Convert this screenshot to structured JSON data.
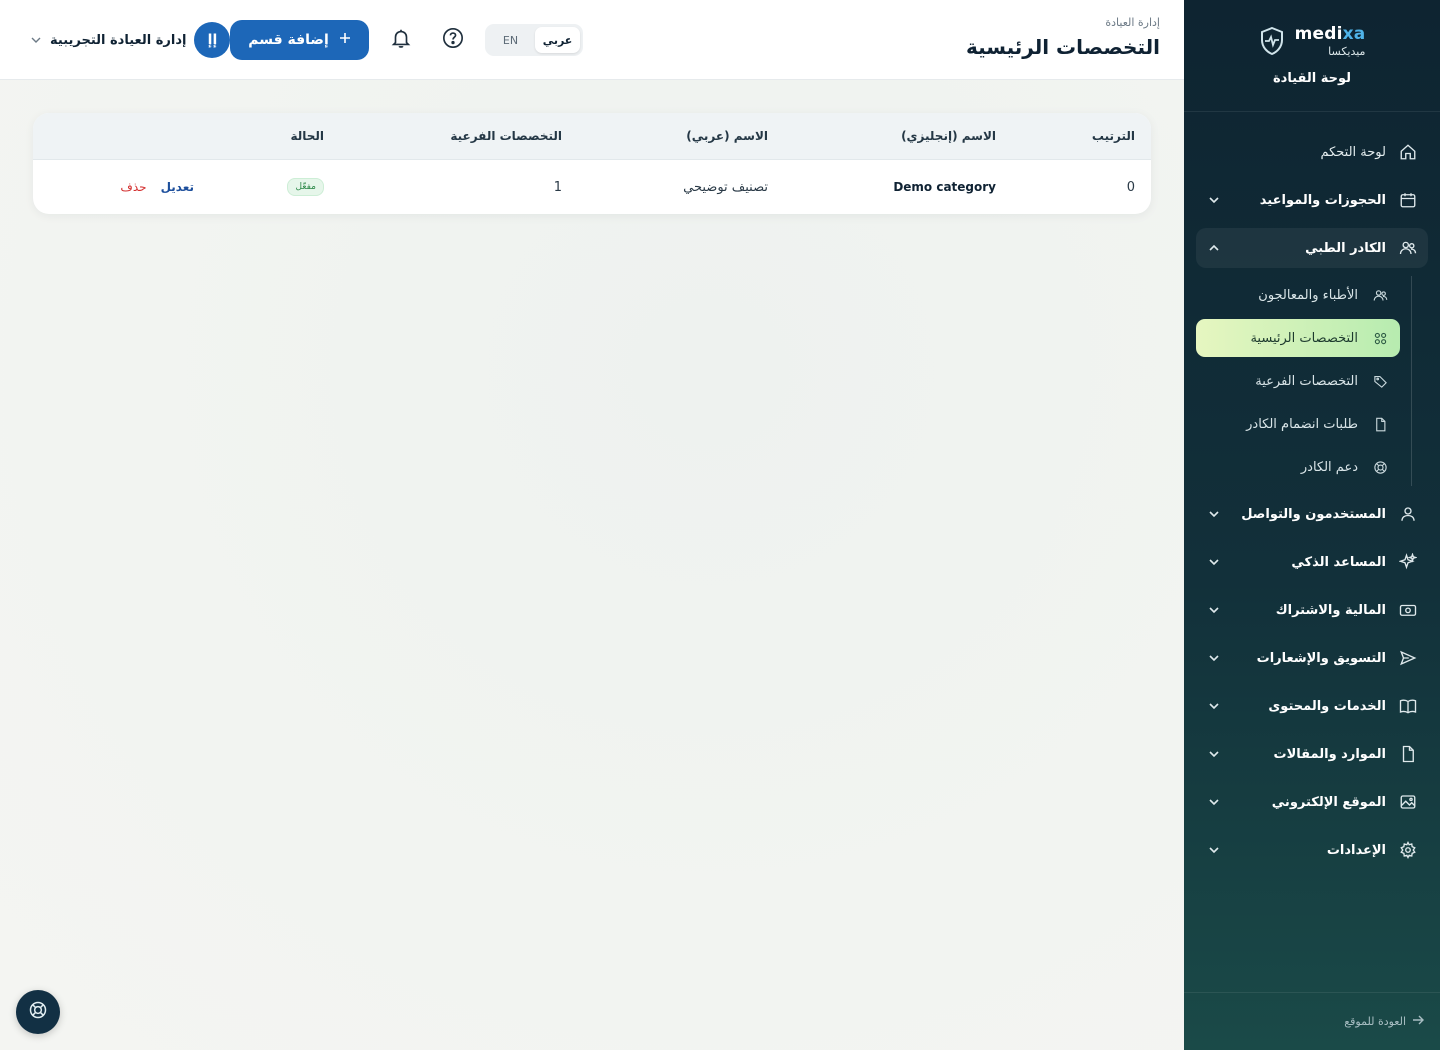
{
  "brand": {
    "name_prefix": "medi",
    "name_accent": "xa",
    "name_ar": "ميديكسا",
    "subtitle": "لوحة القيادة"
  },
  "header": {
    "breadcrumb": "إدارة العيادة",
    "title": "التخصصات الرئيسية",
    "lang_ar": "عربي",
    "lang_en": "EN",
    "add_button": "إضافة قسم",
    "user_initials": "إإ",
    "user_name": "إدارة العيادة التجريبية"
  },
  "sidebar": {
    "items": [
      {
        "label": "لوحة التحكم",
        "icon": "home-icon"
      },
      {
        "label": "الحجوزات والمواعيد",
        "icon": "calendar-icon"
      },
      {
        "label": "الكادر الطبي",
        "icon": "users-icon"
      },
      {
        "label": "المستخدمون والتواصل",
        "icon": "user-icon"
      },
      {
        "label": "المساعد الذكي",
        "icon": "sparkles-icon"
      },
      {
        "label": "المالية والاشتراك",
        "icon": "money-icon"
      },
      {
        "label": "التسويق والإشعارات",
        "icon": "send-icon"
      },
      {
        "label": "الخدمات والمحتوى",
        "icon": "book-icon"
      },
      {
        "label": "الموارد والمقالات",
        "icon": "file-icon"
      },
      {
        "label": "الموقع الإلكتروني",
        "icon": "image-icon"
      },
      {
        "label": "الإعدادات",
        "icon": "gear-icon"
      }
    ],
    "sub_items": [
      {
        "label": "الأطباء والمعالجون",
        "icon": "users-icon"
      },
      {
        "label": "التخصصات الرئيسية",
        "icon": "grid-icon"
      },
      {
        "label": "التخصصات الفرعية",
        "icon": "tag-icon"
      },
      {
        "label": "طلبات انضمام الكادر",
        "icon": "document-icon"
      },
      {
        "label": "دعم الكادر",
        "icon": "lifebuoy-icon"
      }
    ],
    "back_link": "العودة للموقع"
  },
  "table": {
    "columns": [
      "الترتيب",
      "الاسم (إنجليزي)",
      "الاسم (عربي)",
      "التخصصات الفرعية",
      "الحالة",
      ""
    ],
    "rows": [
      {
        "order": "0",
        "name_en": "Demo category",
        "name_ar": "تصنيف توضيحي",
        "sub_count": "1",
        "status": "مفعّل",
        "edit": "تعديل",
        "delete": "حذف"
      }
    ]
  },
  "colors": {
    "primary": "#1d67b8",
    "sidebar": "#0e2431",
    "active": "#c8f0b4",
    "danger": "#d32f2f"
  }
}
